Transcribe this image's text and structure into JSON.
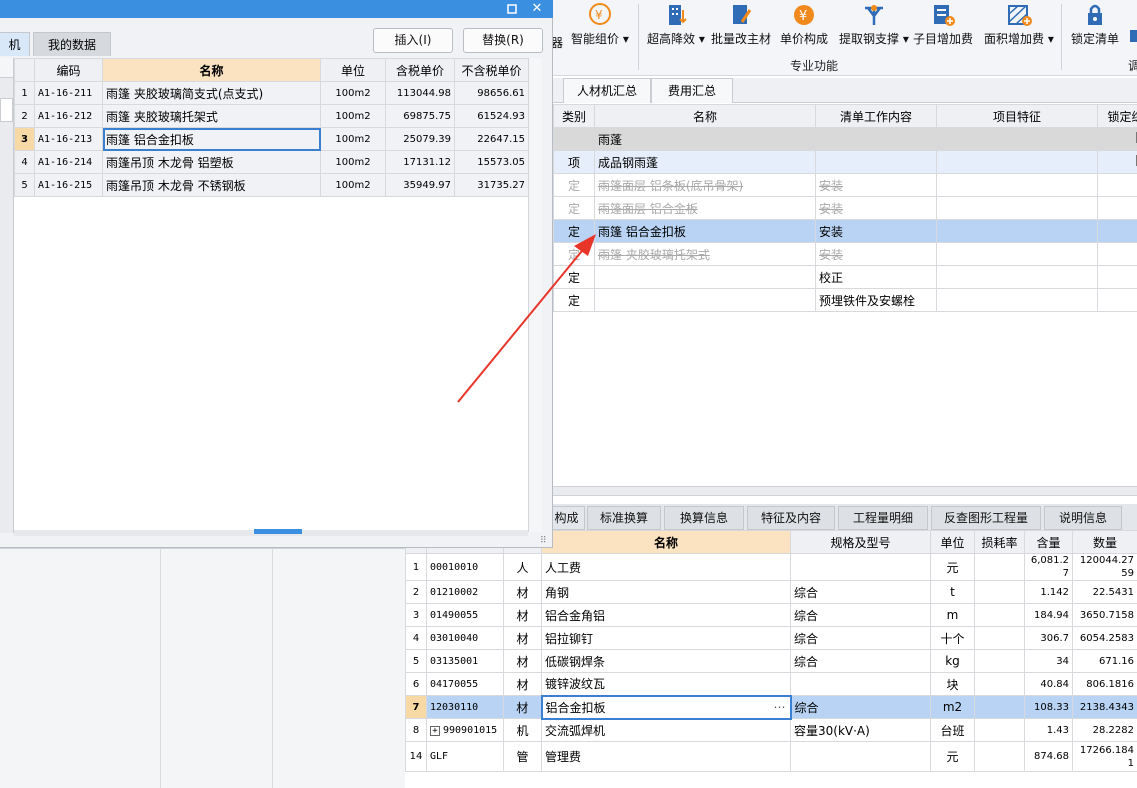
{
  "ribbon": {
    "partial_left_label": "器",
    "buttons": [
      {
        "label": "智能组价",
        "icon": "smart-pricing-icon",
        "dropdown": true
      },
      {
        "label": "超高降效",
        "icon": "high-rise-icon",
        "dropdown": true
      },
      {
        "label": "批量改主材",
        "icon": "batch-material-icon",
        "dropdown": false
      },
      {
        "label": "单价构成",
        "icon": "unit-price-icon",
        "dropdown": false
      },
      {
        "label": "提取钢支撑",
        "icon": "steel-support-icon",
        "dropdown": true
      },
      {
        "label": "子目增加费",
        "icon": "sub-item-fee-icon",
        "dropdown": false
      },
      {
        "label": "面积增加费",
        "icon": "area-fee-icon",
        "dropdown": true
      },
      {
        "label": "锁定清单",
        "icon": "lock-icon",
        "dropdown": false
      }
    ],
    "group_label": "专业功能",
    "group_label_partial": "调"
  },
  "main_tabs": [
    "人材机汇总",
    "费用汇总"
  ],
  "main_table": {
    "headers": [
      "类别",
      "名称",
      "清单工作内容",
      "项目特征",
      "锁定综"
    ],
    "rows": [
      {
        "type": "",
        "name": "雨蓬",
        "content": "",
        "feature": "",
        "style": "group"
      },
      {
        "type": "项",
        "name": "成品钢雨蓬",
        "content": "",
        "feature": "",
        "style": "item"
      },
      {
        "type": "定",
        "name": "雨篷面层 铝条板(底吊骨架)",
        "content": "安装",
        "feature": "",
        "style": "strike"
      },
      {
        "type": "定",
        "name": "雨篷面层 铝合金板",
        "content": "安装",
        "feature": "",
        "style": "strike"
      },
      {
        "type": "定",
        "name": "雨篷 铝合金扣板",
        "content": "安装",
        "feature": "",
        "style": "selected"
      },
      {
        "type": "定",
        "name": "雨篷 夹胶玻璃托架式",
        "content": "安装",
        "feature": "",
        "style": "strike"
      },
      {
        "type": "定",
        "name": "",
        "content": "校正",
        "feature": "",
        "style": "normal"
      },
      {
        "type": "定",
        "name": "",
        "content": "预埋铁件及安螺栓",
        "feature": "",
        "style": "normal"
      }
    ]
  },
  "detail_tabs": [
    "构成",
    "标准换算",
    "换算信息",
    "特征及内容",
    "工程量明细",
    "反查图形工程量",
    "说明信息"
  ],
  "detail_table": {
    "headers": [
      "",
      "",
      "",
      "名称",
      "规格及型号",
      "单位",
      "损耗率",
      "含量",
      "数量"
    ],
    "rows": [
      {
        "no": "1",
        "code": "00010010",
        "cat": "人",
        "name": "人工费",
        "spec": "",
        "unit": "元",
        "loss": "",
        "qty": "6,081.27",
        "amount": "120044.2759"
      },
      {
        "no": "2",
        "code": "01210002",
        "cat": "材",
        "name": "角钢",
        "spec": "综合",
        "unit": "t",
        "loss": "",
        "qty": "1.142",
        "amount": "22.5431"
      },
      {
        "no": "3",
        "code": "01490055",
        "cat": "材",
        "name": "铝合金角铝",
        "spec": "综合",
        "unit": "m",
        "loss": "",
        "qty": "184.94",
        "amount": "3650.7158"
      },
      {
        "no": "4",
        "code": "03010040",
        "cat": "材",
        "name": "铝拉铆钉",
        "spec": "综合",
        "unit": "十个",
        "loss": "",
        "qty": "306.7",
        "amount": "6054.2583"
      },
      {
        "no": "5",
        "code": "03135001",
        "cat": "材",
        "name": "低碳钢焊条",
        "spec": "综合",
        "unit": "kg",
        "loss": "",
        "qty": "34",
        "amount": "671.16"
      },
      {
        "no": "6",
        "code": "04170055",
        "cat": "材",
        "name": "镀锌波纹瓦",
        "spec": "",
        "unit": "块",
        "loss": "",
        "qty": "40.84",
        "amount": "806.1816"
      },
      {
        "no": "7",
        "code": "12030110",
        "cat": "材",
        "name": "铝合金扣板",
        "spec": "综合",
        "unit": "m2",
        "loss": "",
        "qty": "108.33",
        "amount": "2138.4343"
      },
      {
        "no": "8",
        "code": "990901015",
        "cat": "机",
        "name": "交流弧焊机",
        "spec": "容量30(kV·A)",
        "unit": "台班",
        "loss": "",
        "qty": "1.43",
        "amount": "28.2282"
      },
      {
        "no": "14",
        "code": "GLF",
        "cat": "管",
        "name": "管理费",
        "spec": "",
        "unit": "元",
        "loss": "",
        "qty": "874.68",
        "amount": "17266.1841"
      }
    ]
  },
  "dialog": {
    "tabs": [
      "机",
      "我的数据"
    ],
    "insert_label": "插入(I)",
    "replace_label": "替换(R)",
    "headers": [
      "",
      "编码",
      "名称",
      "单位",
      "含税单价",
      "不含税单价"
    ],
    "rows": [
      {
        "no": "1",
        "code": "A1-16-211",
        "name": "雨篷 夹胶玻璃简支式(点支式)",
        "unit": "100m2",
        "price_tax": "113044.98",
        "price_notax": "98656.61"
      },
      {
        "no": "2",
        "code": "A1-16-212",
        "name": "雨篷 夹胶玻璃托架式",
        "unit": "100m2",
        "price_tax": "69875.75",
        "price_notax": "61524.93"
      },
      {
        "no": "3",
        "code": "A1-16-213",
        "name": "雨篷 铝合金扣板",
        "unit": "100m2",
        "price_tax": "25079.39",
        "price_notax": "22647.15"
      },
      {
        "no": "4",
        "code": "A1-16-214",
        "name": "雨篷吊顶 木龙骨 铝塑板",
        "unit": "100m2",
        "price_tax": "17131.12",
        "price_notax": "15573.05"
      },
      {
        "no": "5",
        "code": "A1-16-215",
        "name": "雨篷吊顶 木龙骨 不锈钢板",
        "unit": "100m2",
        "price_tax": "35949.97",
        "price_notax": "31735.27"
      }
    ]
  },
  "colors": {
    "accent": "#3b8fe0",
    "selection": "#b8d3f3",
    "header_highlight": "#fbe3c2",
    "arrow": "#e8352a"
  }
}
